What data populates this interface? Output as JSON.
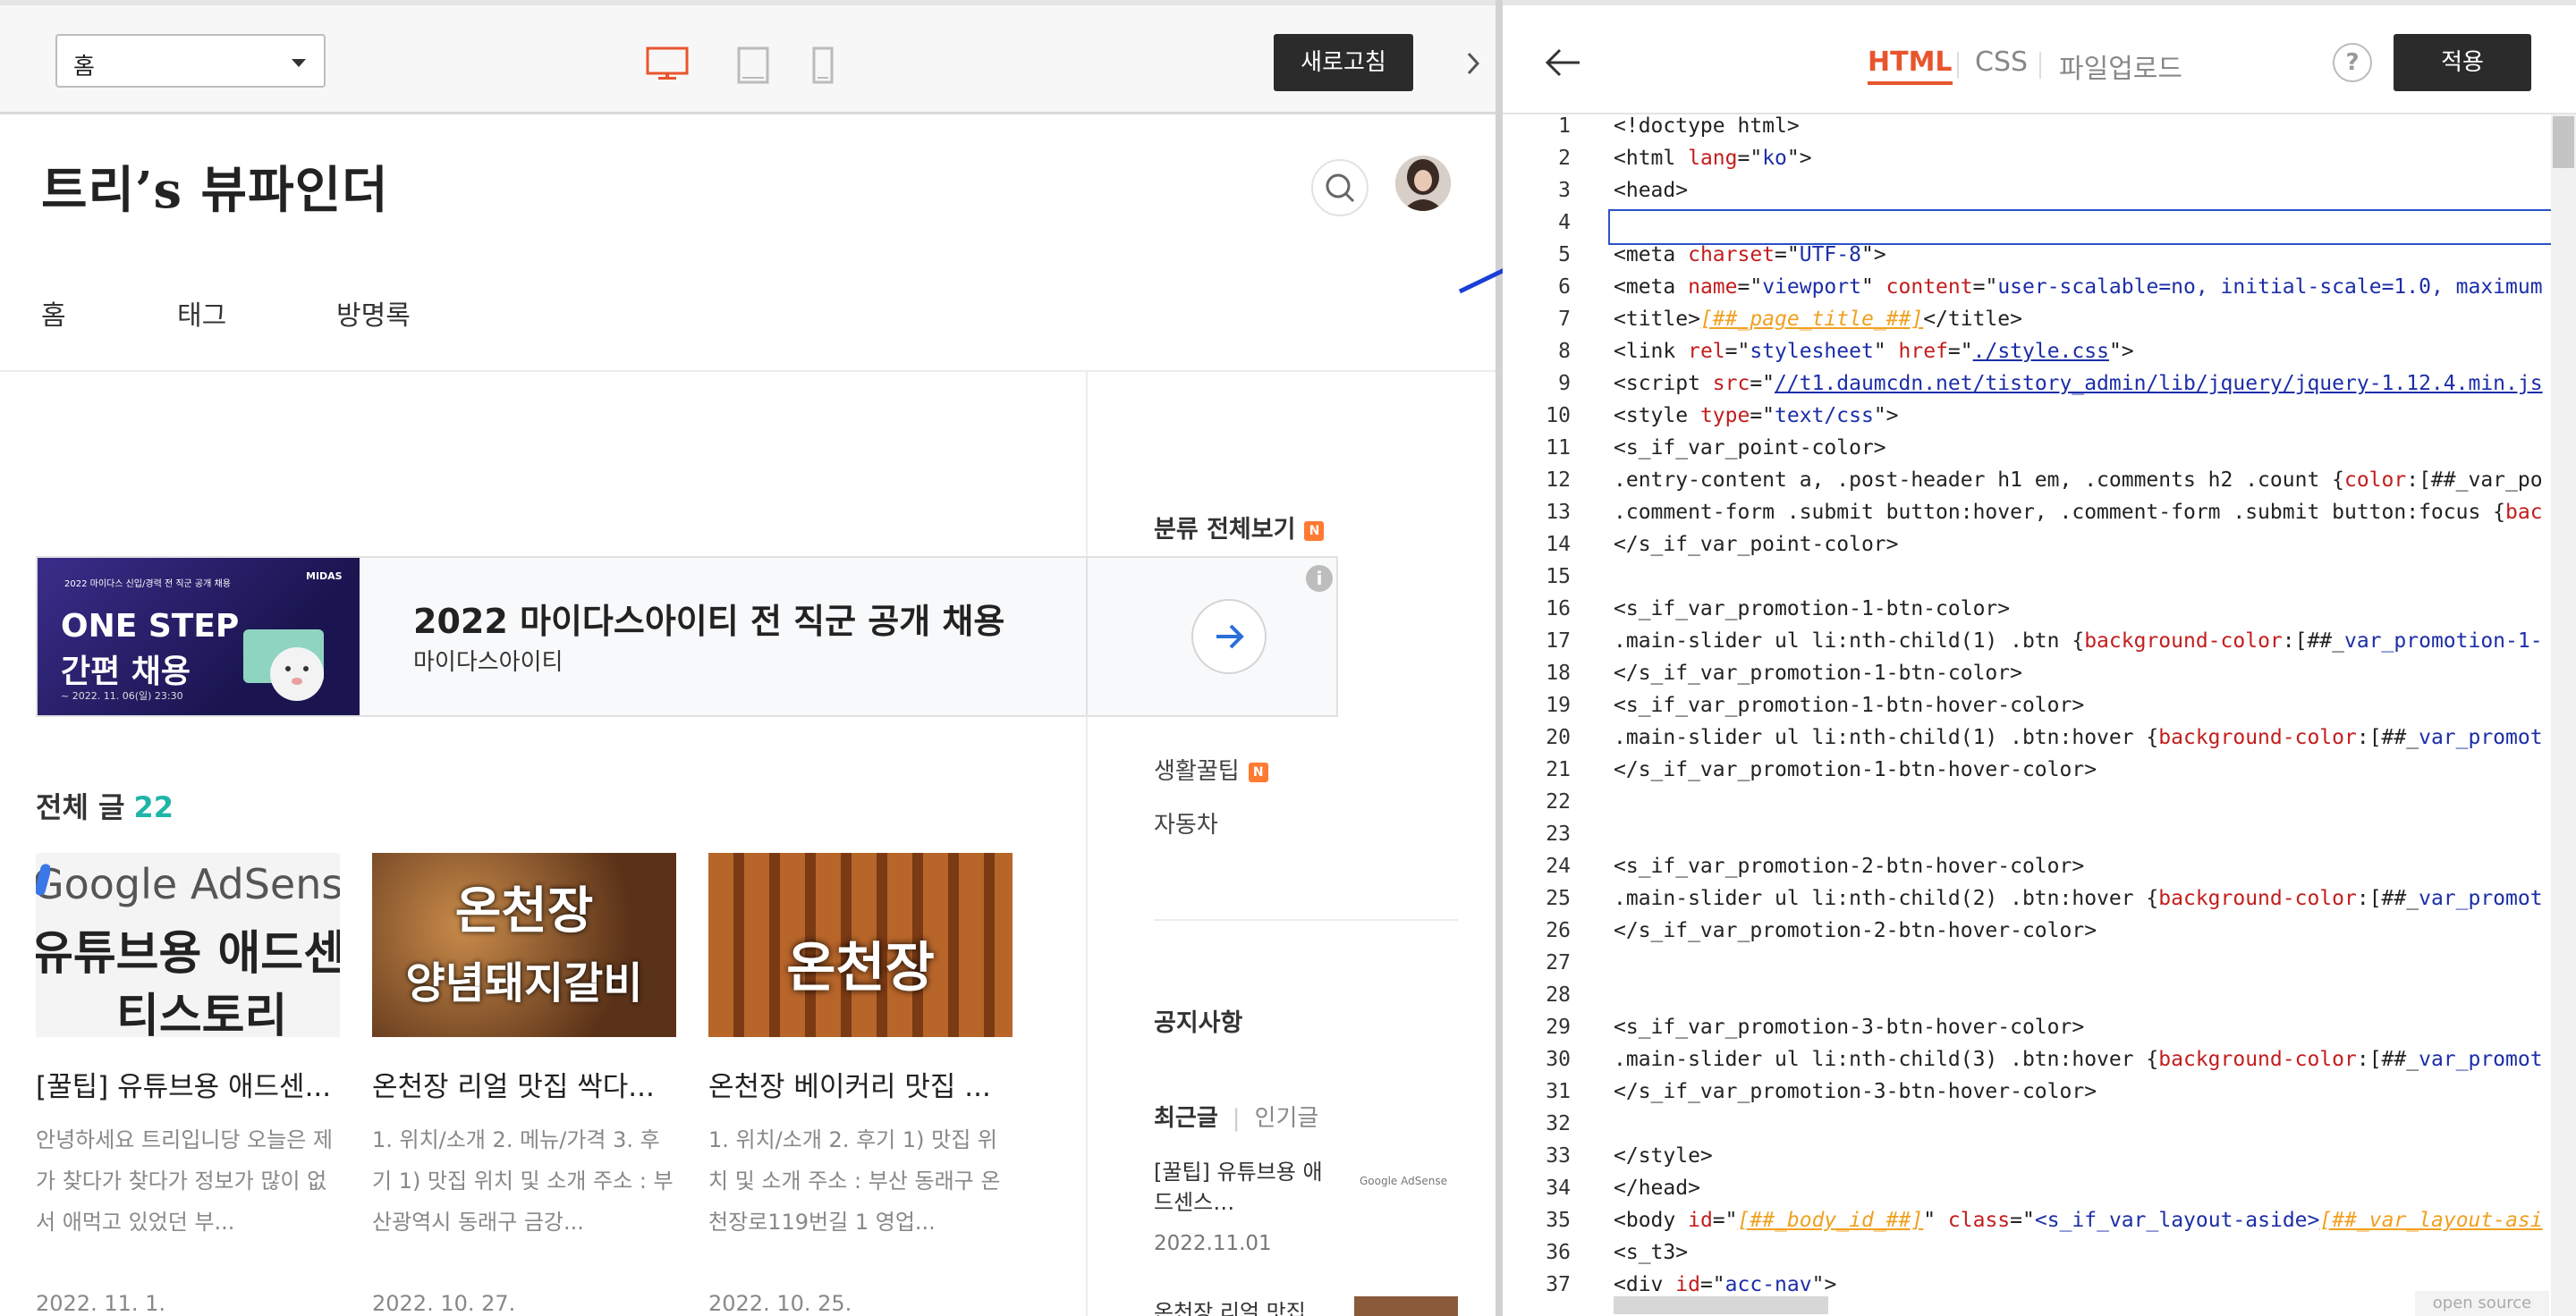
{
  "preview": {
    "page_select": "홈",
    "refresh_label": "새로고침"
  },
  "blog": {
    "title": "트리’s 뷰파인더",
    "nav": [
      "홈",
      "태그",
      "방명록"
    ],
    "ad": {
      "headline": "2022 마이다스아이티 전 직군 공개 채용",
      "advertiser": "마이다스아이티",
      "image_text_top": "2022 마이다스 신입/경력 전 직군 공개 채용",
      "image_text_brand": "MIDAS",
      "image_text_main1": "ONE STEP",
      "image_text_main2": "간편 채용",
      "image_text_date": "~ 2022. 11. 06(일) 23:30"
    },
    "all_posts_label": "전체 글",
    "all_posts_count": "22",
    "posts": [
      {
        "title": "[꿀팁] 유튜브용 애드센...",
        "excerpt": "안녕하세요 트리입니당 오늘은 제가 찾다가 찾다가 정보가 많이 없서 애먹고 있었던 부...",
        "date": "2022. 11. 1.",
        "thumb_line1": "Google AdSense",
        "thumb_line2": "유튜브용 애드센스",
        "thumb_line3": "티스토리"
      },
      {
        "title": "온천장 리얼 맛집 싹다...",
        "excerpt": "1. 위치/소개 2. 메뉴/가격 3. 후기 1) 맛집 위치 및 소개 주소 : 부산광역시 동래구 금강...",
        "date": "2022. 10. 27.",
        "thumb_line1": "온천장",
        "thumb_line2": "양념돼지갈비"
      },
      {
        "title": "온천장 베이커리 맛집 ...",
        "excerpt": "1. 위치/소개 2. 후기 1) 맛집 위치 및 소개 주소 : 부산 동래구 온천장로119번길 1 영업...",
        "date": "2022. 10. 25.",
        "thumb_line1": "온천장"
      }
    ],
    "sidebar": {
      "category_all": "분류 전체보기",
      "categories": [
        "생활꿀팁",
        "자동차"
      ],
      "notice": "공지사항",
      "tab_recent": "최근글",
      "tab_popular": "인기글",
      "recent": [
        {
          "title": "[꿀팁] 유튜브용 애드센스…",
          "date": "2022.11.01",
          "thumb": "Google AdSense"
        },
        {
          "title": "온천장 리얼 맛집",
          "date": ""
        }
      ]
    }
  },
  "editor": {
    "tabs": [
      "HTML",
      "CSS",
      "파일업로드"
    ],
    "help": "?",
    "apply_label": "적용",
    "open_source": "open source",
    "line_numbers": [
      "1",
      "2",
      "3",
      "4",
      "5",
      "6",
      "7",
      "8",
      "9",
      "10",
      "11",
      "12",
      "13",
      "14",
      "15",
      "16",
      "17",
      "18",
      "19",
      "20",
      "21",
      "22",
      "23",
      "24",
      "25",
      "26",
      "27",
      "28",
      "29",
      "30",
      "31",
      "32",
      "33",
      "34",
      "35",
      "36",
      "37"
    ],
    "code": {
      "l1": "<!doctype html>",
      "l2a": "<html ",
      "l2b": "lang",
      "l2c": "=\"",
      "l2d": "ko",
      "l2e": "\">",
      "l3": "<head>",
      "l5a": "<meta ",
      "l5b": "charset",
      "l5c": "=\"",
      "l5d": "UTF-8",
      "l5e": "\">",
      "l6a": "<meta ",
      "l6b": "name",
      "l6c": "=\"",
      "l6d": "viewport",
      "l6e": "\" ",
      "l6f": "content",
      "l6g": "=\"",
      "l6h": "user-scalable=no, initial-scale=1.0, maximum",
      "l7a": "<title>",
      "l7b": "[##_page_title_##]",
      "l7c": "</title>",
      "l8a": "<link ",
      "l8b": "rel",
      "l8c": "=\"",
      "l8d": "stylesheet",
      "l8e": "\" ",
      "l8f": "href",
      "l8g": "=\"",
      "l8h": "./style.css",
      "l8i": "\">",
      "l9a": "<script ",
      "l9b": "src",
      "l9c": "=\"",
      "l9d": "//t1.daumcdn.net/tistory_admin/lib/jquery/jquery-1.12.4.min.js",
      "l10a": "<style ",
      "l10b": "type",
      "l10c": "=\"",
      "l10d": "text/css",
      "l10e": "\">",
      "l11": "<s_if_var_point-color>",
      "l12a": ".entry-content a, .post-header h1 em, .comments h2 .count {",
      "l12b": "color",
      "l12c": ":[##_var_po",
      "l13a": ".comment-form .submit button:hover, .comment-form .submit button:focus {",
      "l13b": "bac",
      "l14": "</s_if_var_point-color>",
      "l16": "<s_if_var_promotion-1-btn-color>",
      "l17a": ".main-slider ul li:nth-child(1) .btn {",
      "l17b": "background-color",
      "l17c": ":[##_",
      "l17d": "var_promotion-1-",
      "l18": "</s_if_var_promotion-1-btn-color>",
      "l19": "<s_if_var_promotion-1-btn-hover-color>",
      "l20a": ".main-slider ul li:nth-child(1) .btn:hover {",
      "l20b": "background-color",
      "l20c": ":[##_",
      "l20d": "var_promot",
      "l21": "</s_if_var_promotion-1-btn-hover-color>",
      "l24": "<s_if_var_promotion-2-btn-hover-color>",
      "l25a": ".main-slider ul li:nth-child(2) .btn:hover {",
      "l25b": "background-color",
      "l25c": ":[##_",
      "l25d": "var_promot",
      "l26": "</s_if_var_promotion-2-btn-hover-color>",
      "l29": "<s_if_var_promotion-3-btn-hover-color>",
      "l30a": ".main-slider ul li:nth-child(3) .btn:hover {",
      "l30b": "background-color",
      "l30c": ":[##_",
      "l30d": "var_promot",
      "l31": "</s_if_var_promotion-3-btn-hover-color>",
      "l33": "</style>",
      "l34": "</head>",
      "l35a": "<body ",
      "l35b": "id",
      "l35c": "=\"",
      "l35d": "[##_body_id_##]",
      "l35e": "\" ",
      "l35f": "class",
      "l35g": "=\"",
      "l35h": "<s_if_var_layout-aside>",
      "l35i": "[##_var_layout-asi",
      "l36": "<s_t3>",
      "l37a": "<div ",
      "l37b": "id",
      "l37c": "=\"",
      "l37d": "acc-nav",
      "l37e": "\">"
    }
  },
  "colors": {
    "accent_orange": "#e8552c",
    "post_count_teal": "#1fb5a8",
    "dark_button": "#2b2b2b",
    "annotation_blue": "#1a3fd6",
    "code_attr_red": "#c31d1d",
    "code_string_blue": "#1c2ea8",
    "code_placeholder_orange": "#f0a020"
  }
}
